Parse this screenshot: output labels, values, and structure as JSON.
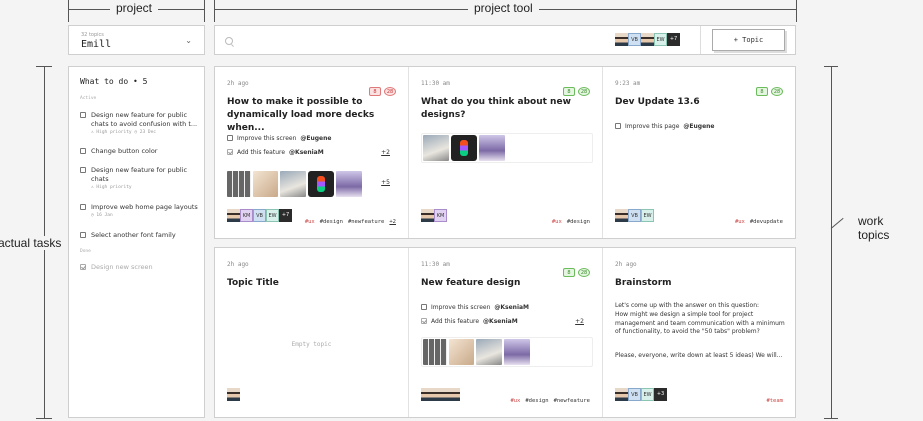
{
  "annotations": {
    "project": "project",
    "project_tool": "project tool",
    "actual_tasks": "actual tasks",
    "work_topics": "work topics"
  },
  "workspace": {
    "small_label": "32 topics",
    "name": "Emill"
  },
  "header": {
    "avatars": [
      {
        "kind": "face"
      },
      {
        "kind": "initials",
        "text": "VB",
        "tone": "blue"
      },
      {
        "kind": "face"
      },
      {
        "kind": "initials",
        "text": "EW",
        "tone": "green"
      },
      {
        "kind": "more",
        "text": "+7"
      }
    ],
    "topic_button": "+ Topic"
  },
  "tasks": {
    "title": "What to do • 5",
    "section_active": "Active",
    "section_done": "Done",
    "items": [
      {
        "text": "Design new feature for public chats to avoid confusion with t...",
        "meta": "⚠ High priority  ◷ 23 Dec",
        "done": false
      },
      {
        "text": "Change button color",
        "meta": "",
        "done": false
      },
      {
        "text": "Design new feature for public chats",
        "meta": "⚠ High priority",
        "done": false
      },
      {
        "text": "Improve web home page layouts",
        "meta": "◷ 16 Jan",
        "done": false
      },
      {
        "text": "Select another font family",
        "meta": "",
        "done": false
      },
      {
        "text": "Design new screen",
        "meta": "",
        "done": true
      }
    ]
  },
  "cards": {
    "c1": {
      "time": "2h ago",
      "title": "How to make it possible to dynamically load more decks when...",
      "badge1": "8",
      "badge2": "28",
      "check1": "Improve this screen",
      "mention1": "@Eugene",
      "check2": "Add this feature",
      "mention2": "@KseniaM",
      "count1": "+2",
      "count2": "+5",
      "count3": "+2",
      "av_more": "+7",
      "av1": "KM",
      "av2": "VB",
      "av3": "EW",
      "tag1": "#ux",
      "tag2": "#design",
      "tag3": "#newfeature"
    },
    "c2": {
      "time": "11:30 am",
      "title": "What do you think about new designs?",
      "badge1": "8",
      "badge2": "28",
      "av1": "KM",
      "tag1": "#ux",
      "tag2": "#design"
    },
    "c3": {
      "time": "9:23 am",
      "title": "Dev Update 13.6",
      "badge1": "8",
      "badge2": "28",
      "check1": "Improve this page",
      "mention1": "@Eugene",
      "av1": "VB",
      "av2": "EW",
      "tag1": "#ux",
      "tag2": "#devupdate"
    },
    "c4": {
      "time": "2h ago",
      "title": "Topic Title",
      "empty": "Empty topic"
    },
    "c5": {
      "time": "11:30 am",
      "title": "New feature design",
      "badge1": "8",
      "badge2": "28",
      "check1": "Improve this screen",
      "mention1": "@KseniaM",
      "check2": "Add this feature",
      "mention2": "@KseniaM",
      "count1": "+2",
      "tag1": "#ux",
      "tag2": "#design",
      "tag3": "#newfeature"
    },
    "c6": {
      "time": "2h ago",
      "title": "Brainstorm",
      "desc1": "Let's come up with the answer on this question:",
      "desc2": "How might we design a simple tool for project management and team communication with a minimum of functionality, to avoid the \"50 tabs\" problem?",
      "desc3": "Please, everyone, write down at least 5 ideas) We will...",
      "av1": "VB",
      "av2": "EW",
      "av_more": "+3",
      "tag1": "#team"
    }
  }
}
